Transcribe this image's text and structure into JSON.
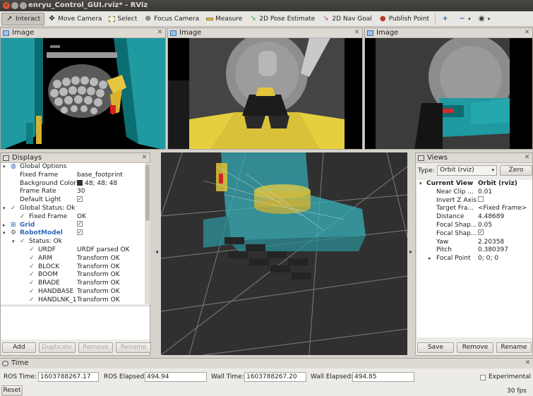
{
  "window": {
    "title": "enryu_Control_GUI.rviz* - RViz"
  },
  "toolbar": {
    "tools": [
      {
        "label": "Interact",
        "icon": "interact-icon"
      },
      {
        "label": "Move Camera",
        "icon": "move-camera-icon"
      },
      {
        "label": "Select",
        "icon": "select-icon"
      },
      {
        "label": "Focus Camera",
        "icon": "focus-camera-icon"
      },
      {
        "label": "Measure",
        "icon": "measure-icon"
      },
      {
        "label": "2D Pose Estimate",
        "icon": "pose-estimate-icon"
      },
      {
        "label": "2D Nav Goal",
        "icon": "nav-goal-icon"
      },
      {
        "label": "Publish Point",
        "icon": "publish-point-icon"
      }
    ]
  },
  "image_panels": [
    {
      "title": "Image"
    },
    {
      "title": "Image"
    },
    {
      "title": "Image"
    }
  ],
  "displays": {
    "title": "Displays",
    "rows": {
      "global_options": "Global Options",
      "fixed_frame": "Fixed Frame",
      "fixed_frame_val": "base_footprint",
      "bg_color": "Background Color",
      "bg_color_val": "48; 48; 48",
      "frame_rate": "Frame Rate",
      "frame_rate_val": "30",
      "default_light": "Default Light",
      "global_status": "Global Status: Ok",
      "gs_fixed_frame": "Fixed Frame",
      "gs_fixed_frame_val": "OK",
      "grid": "Grid",
      "robot_model": "RobotModel",
      "status": "Status: Ok",
      "urdf": "URDF",
      "urdf_val": "URDF parsed OK",
      "arm": "ARM",
      "arm_val": "Transform OK",
      "block": "BLOCK",
      "block_val": "Transform OK",
      "boom": "BOOM",
      "boom_val": "Transform OK",
      "brade": "BRADE",
      "brade_val": "Transform OK",
      "handbase": "HANDBASE",
      "handbase_val": "Transform OK",
      "handlnk": "HANDLNK_1",
      "handlnk_val": "Transform OK"
    },
    "buttons": {
      "add": "Add",
      "duplicate": "Duplicate",
      "remove": "Remove",
      "rename": "Rename"
    }
  },
  "views": {
    "title": "Views",
    "type_label": "Type:",
    "type_value": "Orbit (rviz)",
    "zero": "Zero",
    "current_view": "Current View",
    "current_view_val": "Orbit (rviz)",
    "props": [
      {
        "k": "Near Clip ...",
        "v": "0.01"
      },
      {
        "k": "Invert Z Axis",
        "v": ""
      },
      {
        "k": "Target Fra...",
        "v": "<Fixed Frame>"
      },
      {
        "k": "Distance",
        "v": "4.48689"
      },
      {
        "k": "Focal Shap...",
        "v": "0.05"
      },
      {
        "k": "Focal Shap...",
        "v": ""
      },
      {
        "k": "Yaw",
        "v": "2.20358"
      },
      {
        "k": "Pitch",
        "v": "0.380397"
      },
      {
        "k": "Focal Point",
        "v": "0; 0; 0"
      }
    ],
    "buttons": {
      "save": "Save",
      "remove": "Remove",
      "rename": "Rename"
    }
  },
  "time": {
    "title": "Time",
    "ros_time_label": "ROS Time:",
    "ros_time": "1603788267.17",
    "ros_elapsed_label": "ROS Elapsed:",
    "ros_elapsed": "494.94",
    "wall_time_label": "Wall Time:",
    "wall_time": "1603788267.20",
    "wall_elapsed_label": "Wall Elapsed:",
    "wall_elapsed": "494.85",
    "experimental": "Experimental",
    "reset": "Reset",
    "fps": "30 fps"
  }
}
